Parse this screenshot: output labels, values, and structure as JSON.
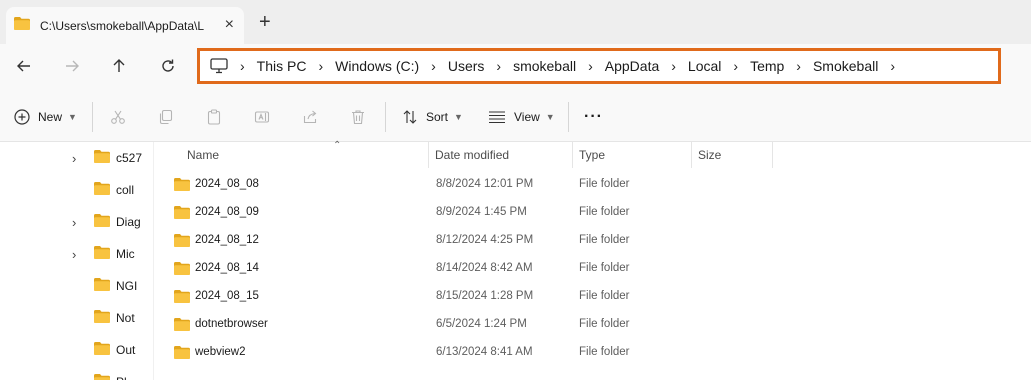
{
  "window": {
    "tab_title": "C:\\Users\\smokeball\\AppData\\L",
    "tab_close": "×",
    "new_tab": "+"
  },
  "address_bar": {
    "crumbs": [
      "This PC",
      "Windows (C:)",
      "Users",
      "smokeball",
      "AppData",
      "Local",
      "Temp",
      "Smokeball"
    ],
    "separator": "›"
  },
  "toolbar": {
    "new_label": "New",
    "sort_label": "Sort",
    "view_label": "View",
    "more_label": "···"
  },
  "nav_pane": {
    "items": [
      {
        "label": "c527",
        "expandable": true
      },
      {
        "label": "coll",
        "expandable": false
      },
      {
        "label": "Diag",
        "expandable": true
      },
      {
        "label": "Mic",
        "expandable": true
      },
      {
        "label": "NGI",
        "expandable": false
      },
      {
        "label": "Not",
        "expandable": false
      },
      {
        "label": "Out",
        "expandable": false
      },
      {
        "label": "Pl",
        "expandable": false
      }
    ]
  },
  "file_list": {
    "columns": {
      "name": "Name",
      "date_modified": "Date modified",
      "type": "Type",
      "size": "Size"
    },
    "rows": [
      {
        "name": "2024_08_08",
        "date": "8/8/2024 12:01 PM",
        "type": "File folder"
      },
      {
        "name": "2024_08_09",
        "date": "8/9/2024 1:45 PM",
        "type": "File folder"
      },
      {
        "name": "2024_08_12",
        "date": "8/12/2024 4:25 PM",
        "type": "File folder"
      },
      {
        "name": "2024_08_14",
        "date": "8/14/2024 8:42 AM",
        "type": "File folder"
      },
      {
        "name": "2024_08_15",
        "date": "8/15/2024 1:28 PM",
        "type": "File folder"
      },
      {
        "name": "dotnetbrowser",
        "date": "6/5/2024 1:24 PM",
        "type": "File folder"
      },
      {
        "name": "webview2",
        "date": "6/13/2024 8:41 AM",
        "type": "File folder"
      }
    ]
  },
  "colors": {
    "accent_highlight": "#e06a1b",
    "folder_yellow": "#f8c340",
    "folder_dark": "#e2a51c"
  }
}
